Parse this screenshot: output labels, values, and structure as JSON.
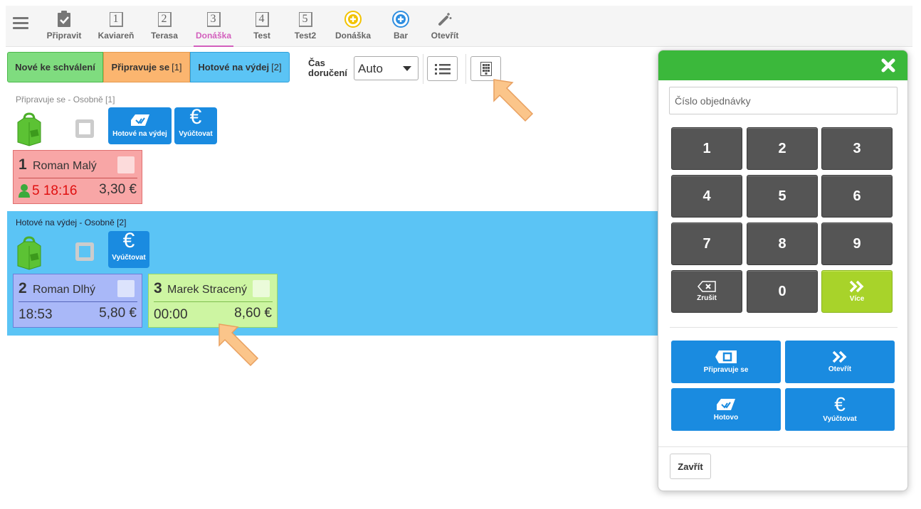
{
  "nav": {
    "items": [
      {
        "label": "Připravit",
        "icon": "clipboard-check-icon"
      },
      {
        "label": "Kaviareň",
        "icon": "table-1-icon",
        "number": "1"
      },
      {
        "label": "Terasa",
        "icon": "table-2-icon",
        "number": "2"
      },
      {
        "label": "Donáška",
        "icon": "table-3-icon",
        "number": "3",
        "active": true
      },
      {
        "label": "Test",
        "icon": "table-4-icon",
        "number": "4"
      },
      {
        "label": "Test2",
        "icon": "table-5-icon",
        "number": "5"
      },
      {
        "label": "Donáška",
        "icon": "add-yellow-icon"
      },
      {
        "label": "Bar",
        "icon": "add-blue-icon"
      },
      {
        "label": "Otevřít",
        "icon": "wand-icon"
      }
    ]
  },
  "filters": {
    "new_label": "Nové ke schválení",
    "prep_label": "Připravuje se",
    "prep_count": "[1]",
    "done_label": "Hotové na výdej",
    "done_count": "[2]"
  },
  "delivery": {
    "label_line1": "Čas",
    "label_line2": "doručení",
    "selected": "Auto"
  },
  "section_preparing": {
    "title": "Připravuje se - Osobně [1]",
    "btn_done": "Hotové na výdej",
    "btn_bill": "Vyúčtovat",
    "orders": [
      {
        "number": "1",
        "name": "Roman Malý",
        "time": "5 18:16",
        "price": "3,30 €"
      }
    ]
  },
  "section_ready": {
    "title": "Hotové na výdej - Osobně [2]",
    "btn_bill": "Vyúčtovat",
    "orders": [
      {
        "number": "2",
        "name": "Roman Dlhý",
        "time": "18:53",
        "price": "5,80 €"
      },
      {
        "number": "3",
        "name": "Marek Stracený",
        "time": "00:00",
        "price": "8,60 €"
      }
    ]
  },
  "keypad": {
    "input_placeholder": "Číslo objednávky",
    "digits": [
      "1",
      "2",
      "3",
      "4",
      "5",
      "6",
      "7",
      "8",
      "9"
    ],
    "zero": "0",
    "clear_label": "Zrušit",
    "more_label": "Více",
    "btn_preparing": "Připravuje se",
    "btn_open": "Otevřít",
    "btn_done": "Hotovo",
    "btn_bill": "Vyúčtovat",
    "close_label": "Zavřít"
  },
  "colors": {
    "accent_pink": "#d35fbd",
    "header_green": "#3bb83b",
    "action_blue": "#1a8be0",
    "ready_band": "#5bc4f5"
  }
}
